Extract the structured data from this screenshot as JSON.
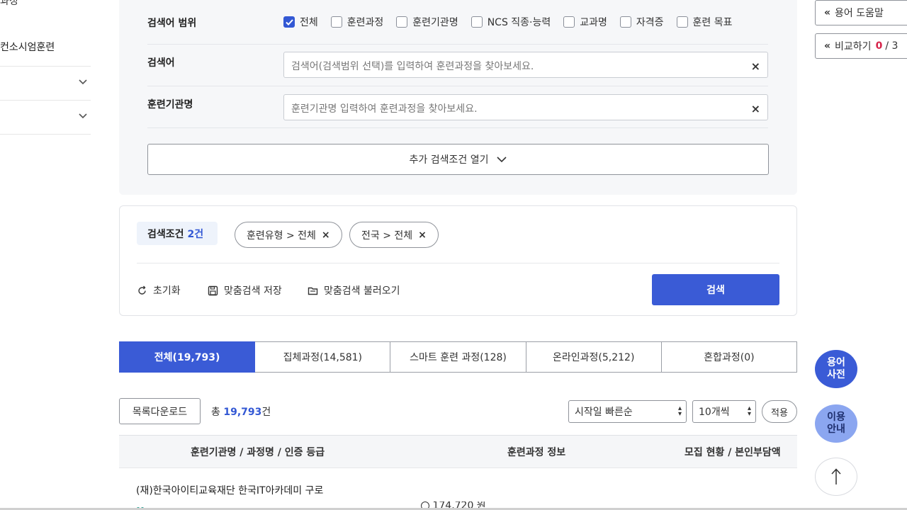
{
  "sidebar": {
    "top_partial": "과정",
    "item1": "컨소시엄훈련",
    "rows": [
      "",
      ""
    ]
  },
  "search": {
    "scope_label": "검색어 범위",
    "scope_options": [
      {
        "label": "전체",
        "checked": true
      },
      {
        "label": "훈련과정",
        "checked": false
      },
      {
        "label": "훈련기관명",
        "checked": false
      },
      {
        "label": "NCS 직종·능력",
        "checked": false
      },
      {
        "label": "교과명",
        "checked": false
      },
      {
        "label": "자격증",
        "checked": false
      },
      {
        "label": "훈련 목표",
        "checked": false
      }
    ],
    "keyword_label": "검색어",
    "keyword_placeholder": "검색어(검색범위 선택)를 입력하여 훈련과정을 찾아보세요.",
    "org_label": "훈련기관명",
    "org_placeholder": "훈련기관명 입력하여 훈련과정을 찾아보세요.",
    "clear_glyph": "×",
    "more_label": "추가 검색조건 열기"
  },
  "conditions": {
    "label": "검색조건",
    "count": "2건",
    "chips": [
      "훈련유형 > 전체",
      "전국 > 전체"
    ],
    "reset_label": "초기화",
    "save_label": "맞춤검색 저장",
    "load_label": "맞춤검색 불러오기",
    "search_button": "검색"
  },
  "tabs": [
    {
      "label": "전체(19,793)",
      "active": true
    },
    {
      "label": "집체과정(14,581)",
      "active": false
    },
    {
      "label": "스마트 훈련 과정(128)",
      "active": false
    },
    {
      "label": "온라인과정(5,212)",
      "active": false
    },
    {
      "label": "혼합과정(0)",
      "active": false
    }
  ],
  "list": {
    "download_label": "목록다운로드",
    "total_prefix": "총",
    "total_count": "19,793",
    "total_suffix": "건",
    "sort_value": "시작일 빠른순",
    "page_size_value": "10개씩",
    "apply_label": "적용"
  },
  "table": {
    "headers": [
      "훈련기관명 / 과정명 / 인증 등급",
      "훈련과정 정보",
      "모집 현황 / 본인부담액"
    ],
    "first_row_org": "(재)한국아이티교육재단 한국IT아카데미 구로",
    "first_row_partial_price": "174,720 원"
  },
  "right_rail": {
    "help_label": "용어 도움말",
    "compare_label": "비교하기",
    "compare_count": "0",
    "compare_total": "/ 3",
    "dict_label": "용어\n사전",
    "guide_label": "이용\n안내",
    "collapse_glyph": "«"
  },
  "colors": {
    "primary": "#3a5bd6",
    "accent_red": "#d6244a",
    "panel_bg": "#f6f7f9"
  }
}
